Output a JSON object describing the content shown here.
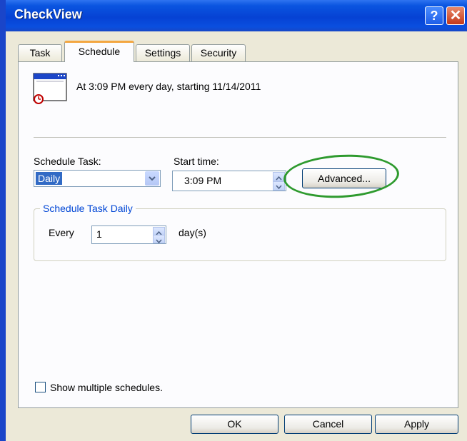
{
  "window": {
    "title": "CheckView"
  },
  "titlebar_buttons": {
    "help": "?",
    "close": "✕"
  },
  "tabs": [
    {
      "label": "Task",
      "active": false
    },
    {
      "label": "Schedule",
      "active": true
    },
    {
      "label": "Settings",
      "active": false
    },
    {
      "label": "Security",
      "active": false
    }
  ],
  "summary": {
    "text": "At 3:09 PM every day, starting 11/14/2011"
  },
  "schedule_task": {
    "label": "Schedule Task:",
    "value": "Daily"
  },
  "start_time": {
    "label": "Start time:",
    "value": "3:09 PM"
  },
  "advanced_button": {
    "label": "Advanced..."
  },
  "group": {
    "title": "Schedule Task Daily",
    "every_label": "Every",
    "every_value": "1",
    "unit_label": "day(s)"
  },
  "show_multiple": {
    "label": "Show multiple schedules.",
    "checked": false
  },
  "footer": {
    "ok": "OK",
    "cancel": "Cancel",
    "apply": "Apply"
  },
  "colors": {
    "titlebar": "#0642d4",
    "highlight": "#316ac5",
    "annotation": "#2e9a2e"
  }
}
